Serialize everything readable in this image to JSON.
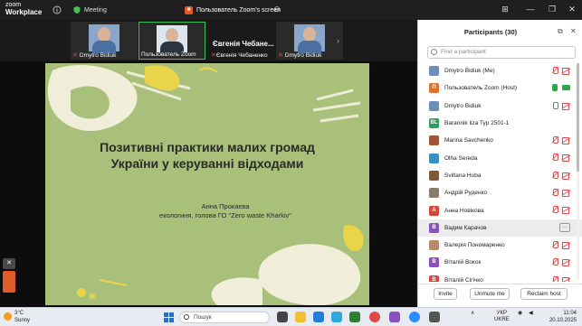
{
  "titlebar": {
    "app_line1": "zoom",
    "app_line2": "Workplace",
    "meeting_label": "Meeting",
    "share_label": "Пользователь Zoom's screen"
  },
  "video_strip": {
    "tiles": [
      {
        "name": "Dmytro Bidiuk",
        "type": "video",
        "muted": true
      },
      {
        "name": "Пользователь Zoom",
        "type": "video",
        "active": true,
        "muted": false
      },
      {
        "name": "Євгенія Чебаненко",
        "big_name": "Євгенія Чебане...",
        "type": "name",
        "muted": true
      },
      {
        "name": "Dmytro Bidiuk",
        "type": "video",
        "muted": true
      }
    ]
  },
  "slide": {
    "title_line1": "Позитивні практики малих громад",
    "title_line2": "України у керуванні відходами",
    "author_line1": "Анна Прокаєва",
    "author_line2": "екологиня, голова ГО \"Zero waste Kharkiv\""
  },
  "participants": {
    "title": "Participants (30)",
    "search_placeholder": "Find a participant",
    "rows": [
      {
        "name": "Dmytro Bidiuk (Me)",
        "avatar_color": "#6b8fb8",
        "avatar_text": "",
        "mic": "off",
        "cam": "off"
      },
      {
        "name": "Пользователь Zoom (Host)",
        "avatar_color": "#e0702a",
        "avatar_text": "П",
        "mic": "on-green",
        "cam": "on"
      },
      {
        "name": "Dmytro Bidiuk",
        "avatar_color": "#6b8fb8",
        "avatar_text": "",
        "mic": "on-grey",
        "cam": "off"
      },
      {
        "name": "Barannik liza Typ 2501-1",
        "avatar_color": "#2e9e5b",
        "avatar_text": "BL",
        "mic": "none",
        "cam": "none"
      },
      {
        "name": "Marina Savchenko",
        "avatar_color": "#a0553a",
        "avatar_text": "",
        "mic": "off",
        "cam": "off"
      },
      {
        "name": "Olha Sereda",
        "avatar_color": "#3a8fc0",
        "avatar_text": "",
        "mic": "off",
        "cam": "off"
      },
      {
        "name": "Svitlana Huba",
        "avatar_color": "#7a5a3a",
        "avatar_text": "",
        "mic": "off",
        "cam": "off"
      },
      {
        "name": "Андрій Руденко",
        "avatar_color": "#8a7a6a",
        "avatar_text": "",
        "mic": "off",
        "cam": "off"
      },
      {
        "name": "Анна Новікова",
        "avatar_color": "#d9453a",
        "avatar_text": "А",
        "mic": "off",
        "cam": "off"
      },
      {
        "name": "Вадим Карачов",
        "avatar_color": "#8a4fc0",
        "avatar_text": "В",
        "mic": "none",
        "cam": "none",
        "hover": true
      },
      {
        "name": "Валерія Пономаренко",
        "avatar_color": "#b88a6a",
        "avatar_text": "",
        "mic": "off",
        "cam": "off"
      },
      {
        "name": "Віталій Вокок",
        "avatar_color": "#8a4fc0",
        "avatar_text": "В",
        "mic": "off",
        "cam": "off"
      },
      {
        "name": "Віталій Сігічко",
        "avatar_color": "#d9453a",
        "avatar_text": "В",
        "mic": "off",
        "cam": "off"
      }
    ],
    "more_label": "···",
    "invite_label": "Invite",
    "unmute_label": "Unmute me",
    "reclaim_label": "Reclaim host"
  },
  "taskbar": {
    "temp": "3°C",
    "weather": "Sunny",
    "search_label": "Пошук",
    "lang1": "УКР",
    "lang2": "UKRE",
    "time": "11:04",
    "date": "20.10.2025"
  }
}
